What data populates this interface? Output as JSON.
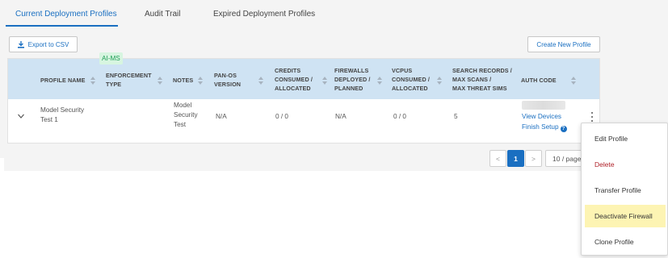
{
  "tabs": [
    {
      "label": "Current Deployment Profiles",
      "active": true
    },
    {
      "label": "Audit Trail",
      "active": false
    },
    {
      "label": "Expired Deployment Profiles",
      "active": false
    }
  ],
  "toolbar": {
    "export_label": "Export to CSV",
    "create_label": "Create New Profile"
  },
  "table": {
    "headers": [
      [
        "PROFILE NAME"
      ],
      [
        "ENFORCEMENT",
        "TYPE"
      ],
      [
        "NOTES"
      ],
      [
        "PAN-OS",
        "VERSION"
      ],
      [
        "CREDITS",
        "CONSUMED /",
        "ALLOCATED"
      ],
      [
        "FIREWALLS",
        "DEPLOYED /",
        "PLANNED"
      ],
      [
        "VCPUS",
        "CONSUMED /",
        "ALLOCATED"
      ],
      [
        "SEARCH RECORDS /",
        "MAX SCANS /",
        "MAX THREAT SIMS"
      ],
      [
        "AUTH CODE"
      ]
    ],
    "row": {
      "profile_name": [
        "Model Security",
        "Test   1"
      ],
      "enforcement_type": "AI-MS",
      "notes": [
        "Model",
        "Security",
        "Test"
      ],
      "panos_version": "N/A",
      "credits": "0 / 0",
      "firewalls": "N/A",
      "vcpus": "0 / 0",
      "search_records": "5",
      "view_devices": "View Devices",
      "finish_setup": "Finish Setup"
    }
  },
  "pagination": {
    "prev": "<",
    "current": "1",
    "next": ">",
    "page_size": "10 / page"
  },
  "menu": {
    "items": [
      {
        "label": "Edit Profile"
      },
      {
        "label": "Delete"
      },
      {
        "label": "Transfer Profile"
      },
      {
        "label": "Deactivate Firewall"
      },
      {
        "label": "Clone Profile"
      }
    ]
  },
  "colors": {
    "accent": "#1a6fc1",
    "header_bg": "#cfe3f3",
    "badge_bg": "#d7f5e0",
    "badge_text": "#1f9d55",
    "danger": "#b0222a",
    "highlight": "#fdf4b3"
  },
  "icons": [
    "download-icon",
    "sort-icon",
    "chevron-down-icon",
    "kebab-menu-icon",
    "help-icon"
  ]
}
